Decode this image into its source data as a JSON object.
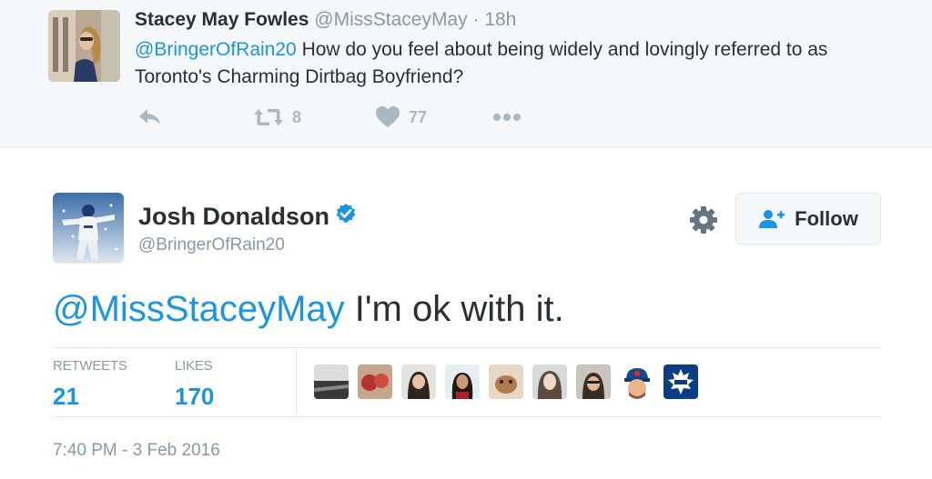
{
  "parent_tweet": {
    "author_name": "Stacey May Fowles",
    "author_handle": "@MissStaceyMay",
    "separator": "·",
    "time": "18h",
    "mention": "@BringerOfRain20",
    "text": " How do you feel about being widely and lovingly referred to as Toronto's Charming Dirtbag Boyfriend?",
    "actions": {
      "reply_icon": "reply-icon",
      "retweet_icon": "retweet-icon",
      "retweet_count": "8",
      "like_icon": "heart-icon",
      "like_count": "77",
      "more_icon": "more-dots-icon"
    }
  },
  "main_tweet": {
    "author_name": "Josh Donaldson",
    "verified_icon": "verified-badge-icon",
    "author_handle": "@BringerOfRain20",
    "follow_label": "Follow",
    "mention": "@MissStaceyMay",
    "text": " I'm ok with it.",
    "stats": {
      "retweets_label": "RETWEETS",
      "retweets_value": "21",
      "likes_label": "LIKES",
      "likes_value": "170"
    },
    "timestamp": "7:40 PM - 3 Feb 2016"
  },
  "colors": {
    "link": "#1b95e0",
    "muted": "#8899a6",
    "text": "#292f33",
    "icon": "#aab8c2",
    "parent_bg": "#f5f8fa",
    "border": "#e1e8ed"
  }
}
